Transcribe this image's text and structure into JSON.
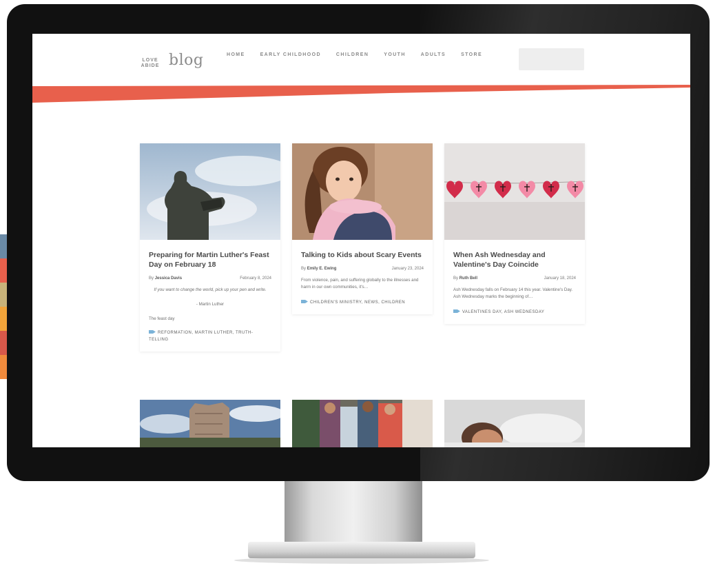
{
  "colors": {
    "accent": "#e8604c",
    "strip": [
      "#6a8aa6",
      "#e8604c",
      "#c9b37a",
      "#f2a43a",
      "#d8584a",
      "#f08a3c"
    ]
  },
  "site": {
    "logo_mark": "LOVE ABIDE",
    "logo_text": "blog",
    "nav": [
      "HOME",
      "EARLY CHILDHOOD",
      "CHILDREN",
      "YOUTH",
      "ADULTS",
      "STORE"
    ]
  },
  "cards": [
    {
      "title": "Preparing for Martin Luther's Feast Day on February 18",
      "author_prefix": "By",
      "author": "Jessica Davis",
      "date": "February 8, 2024",
      "quote": "If you want to change the world, pick up your pen and write.",
      "attribution": "- Martin Luther",
      "excerpt": "The feast day",
      "tags": "REFORMATION, MARTIN LUTHER, TRUTH-TELLING",
      "image_icon": "statue-photo"
    },
    {
      "title": "Talking to Kids about Scary Events",
      "author_prefix": "By",
      "author": "Emily E. Ewing",
      "date": "January 23, 2024",
      "excerpt": "From violence, pain, and suffering globally to the illnesses and harm in our own communities, it's…",
      "tags": "CHILDREN'S MINISTRY, NEWS, CHILDREN",
      "image_icon": "child-photo"
    },
    {
      "title": "When Ash Wednesday and Valentine's Day Coincide",
      "author_prefix": "By",
      "author": "Ruth Bell",
      "date": "January 18, 2024",
      "excerpt": "Ash Wednesday falls on February 14 this year. Valentine's Day. Ash Wednesday marks the beginning of…",
      "tags": "VALENTINES DAY, ASH WEDNESDAY",
      "image_icon": "hearts-photo"
    }
  ]
}
